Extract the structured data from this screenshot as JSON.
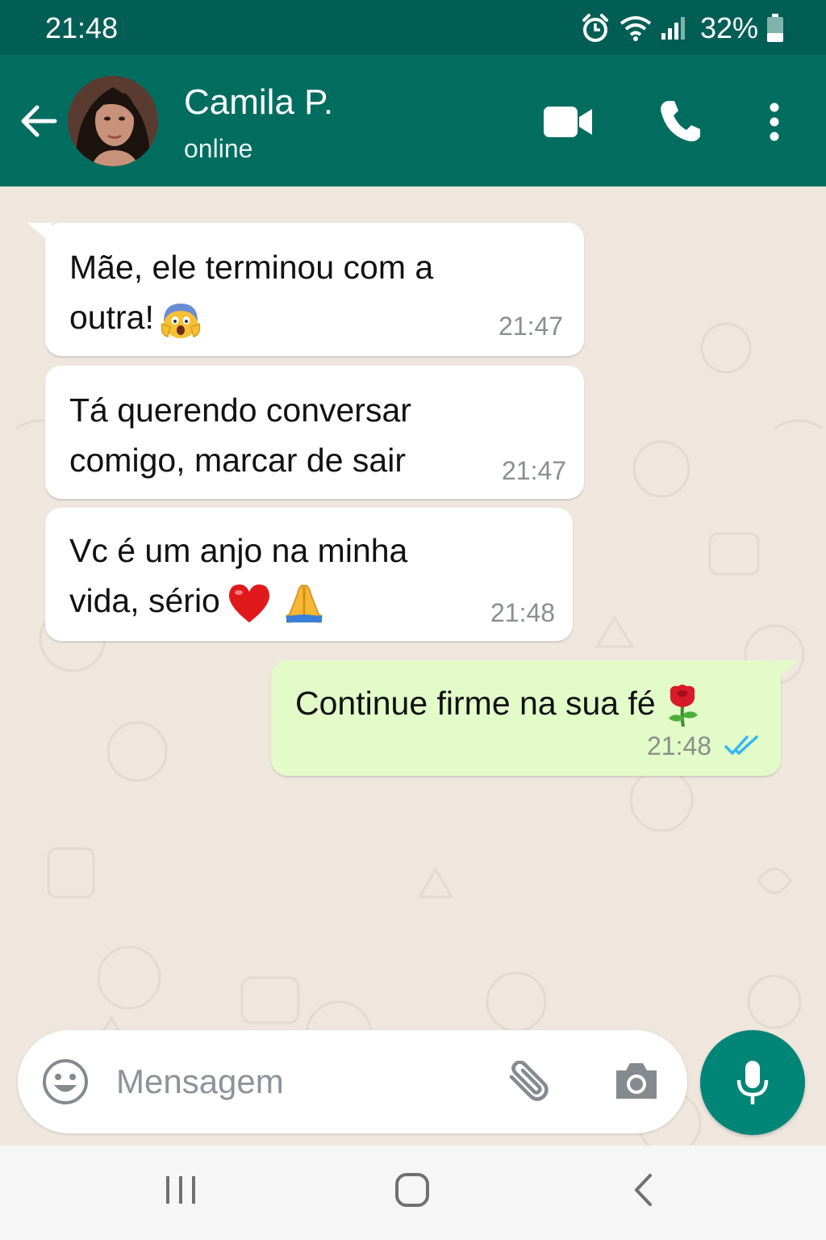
{
  "status_bar": {
    "time": "21:48",
    "battery": "32%"
  },
  "header": {
    "contact_name": "Camila P.",
    "contact_status": "online"
  },
  "messages": [
    {
      "direction": "incoming",
      "lines": [
        "Mãe, ele terminou com a",
        "outra!"
      ],
      "emoji": "scream-emoji",
      "time": "21:47"
    },
    {
      "direction": "incoming",
      "lines": [
        "Tá querendo conversar",
        "comigo, marcar de sair"
      ],
      "time": "21:47"
    },
    {
      "direction": "incoming",
      "lines": [
        "Vc é um anjo na minha",
        "vida, sério"
      ],
      "emoji": "heart-and-pray-emoji",
      "time": "21:48"
    },
    {
      "direction": "outgoing",
      "lines": [
        "Continue firme na sua fé"
      ],
      "emoji": "rose-emoji",
      "time": "21:48",
      "status": "read"
    }
  ],
  "composer": {
    "placeholder": "Mensagem"
  },
  "colors": {
    "header": "#006d5f",
    "status_bar": "#005e54",
    "outgoing_bubble": "#e2fbc9",
    "mic_button": "#008577",
    "read_ticks": "#34b7f1"
  }
}
